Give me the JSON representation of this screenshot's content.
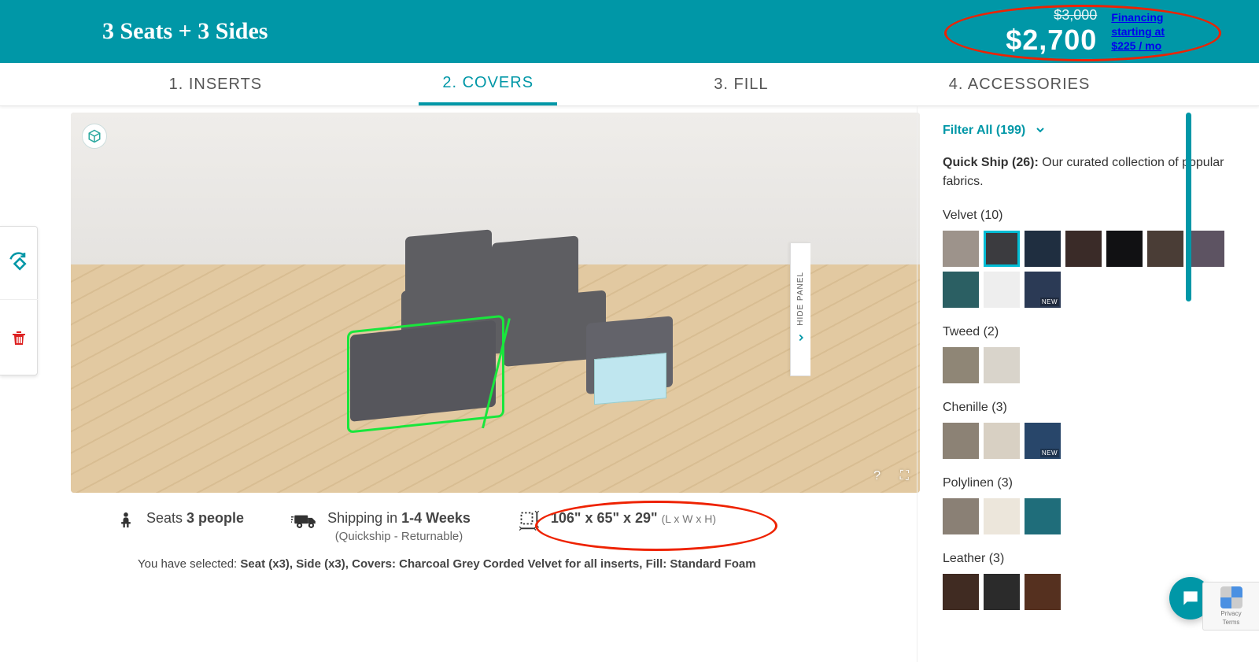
{
  "header": {
    "title": "3 Seats + 3 Sides",
    "price_strike": "$3,000",
    "price_current": "$2,700",
    "financing_line1": "Financing",
    "financing_line2": "starting at",
    "financing_line3": "$225 / mo"
  },
  "tabs": [
    {
      "label": "1. INSERTS",
      "active": false
    },
    {
      "label": "2. COVERS",
      "active": true
    },
    {
      "label": "3. FILL",
      "active": false
    },
    {
      "label": "4. ACCESSORIES",
      "active": false
    }
  ],
  "viewer": {
    "help_char": "?",
    "fullscreen_char": "⛶"
  },
  "info": {
    "seats_prefix": "Seats ",
    "seats_bold": "3 people",
    "shipping_prefix": "Shipping in ",
    "shipping_bold": "1-4 Weeks",
    "shipping_sub": "(Quickship - Returnable)",
    "dimensions": "106\" x 65\" x 29\"",
    "dimensions_sub": "(L x W x H)"
  },
  "selected_line_prefix": "You have selected: ",
  "selected_line_bold": "Seat (x3), Side (x3), Covers: Charcoal Grey Corded Velvet for all inserts, Fill: Standard Foam",
  "panel": {
    "filter_label": "Filter All (199)",
    "quickship_bold": "Quick Ship (26):",
    "quickship_rest": " Our curated collection of popular fabrics.",
    "hide_label": "HIDE PANEL",
    "sections": [
      {
        "title": "Velvet (10)",
        "swatches": [
          {
            "color": "#9d938b"
          },
          {
            "color": "#3b3b3f",
            "selected": true
          },
          {
            "color": "#1f2e40"
          },
          {
            "color": "#3a2b28"
          },
          {
            "color": "#111113"
          },
          {
            "color": "#4a3d36"
          },
          {
            "color": "#5d5362"
          },
          {
            "color": "#2b5f63"
          },
          {
            "color": "#eeeeee"
          },
          {
            "color": "#2b3a55",
            "new": "NEW"
          }
        ]
      },
      {
        "title": "Tweed (2)",
        "swatches": [
          {
            "color": "#8f8676"
          },
          {
            "color": "#d9d4cb"
          }
        ]
      },
      {
        "title": "Chenille (3)",
        "swatches": [
          {
            "color": "#8c8275"
          },
          {
            "color": "#d8d0c3"
          },
          {
            "color": "#28466a",
            "new": "NEW"
          }
        ]
      },
      {
        "title": "Polylinen (3)",
        "swatches": [
          {
            "color": "#8a8075"
          },
          {
            "color": "#ece6db"
          },
          {
            "color": "#1f6d7a"
          }
        ]
      },
      {
        "title": "Leather (3)",
        "swatches": [
          {
            "color": "#402b22"
          },
          {
            "color": "#2b2b2b"
          },
          {
            "color": "#55301f"
          }
        ]
      }
    ]
  },
  "recaptcha": {
    "l1": "Privacy",
    "l2": "Terms"
  }
}
